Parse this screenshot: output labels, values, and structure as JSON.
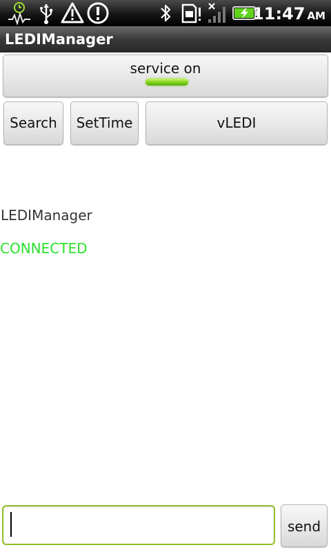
{
  "status_bar": {
    "time": "11:47",
    "ampm": "AM",
    "icons": [
      "sync-gauge-icon",
      "usb-icon",
      "warning-icon",
      "alert-circle-icon",
      "bluetooth-icon",
      "sim-card-icon",
      "no-signal-icon",
      "battery-charging-icon"
    ],
    "battery_level": 0.9,
    "accent_green": "#5fd21c"
  },
  "title_bar": {
    "title": "LEDIManager"
  },
  "service_button": {
    "label": "service on",
    "led_color": "#7ed21a"
  },
  "actions": {
    "search_label": "Search",
    "settime_label": "SetTime",
    "vledi_label": "vLEDI"
  },
  "content": {
    "app_name": "LEDIManager",
    "connection_status": "CONNECTED",
    "connection_status_color": "#2be12b"
  },
  "input_row": {
    "message_value": "",
    "send_label": "send"
  }
}
